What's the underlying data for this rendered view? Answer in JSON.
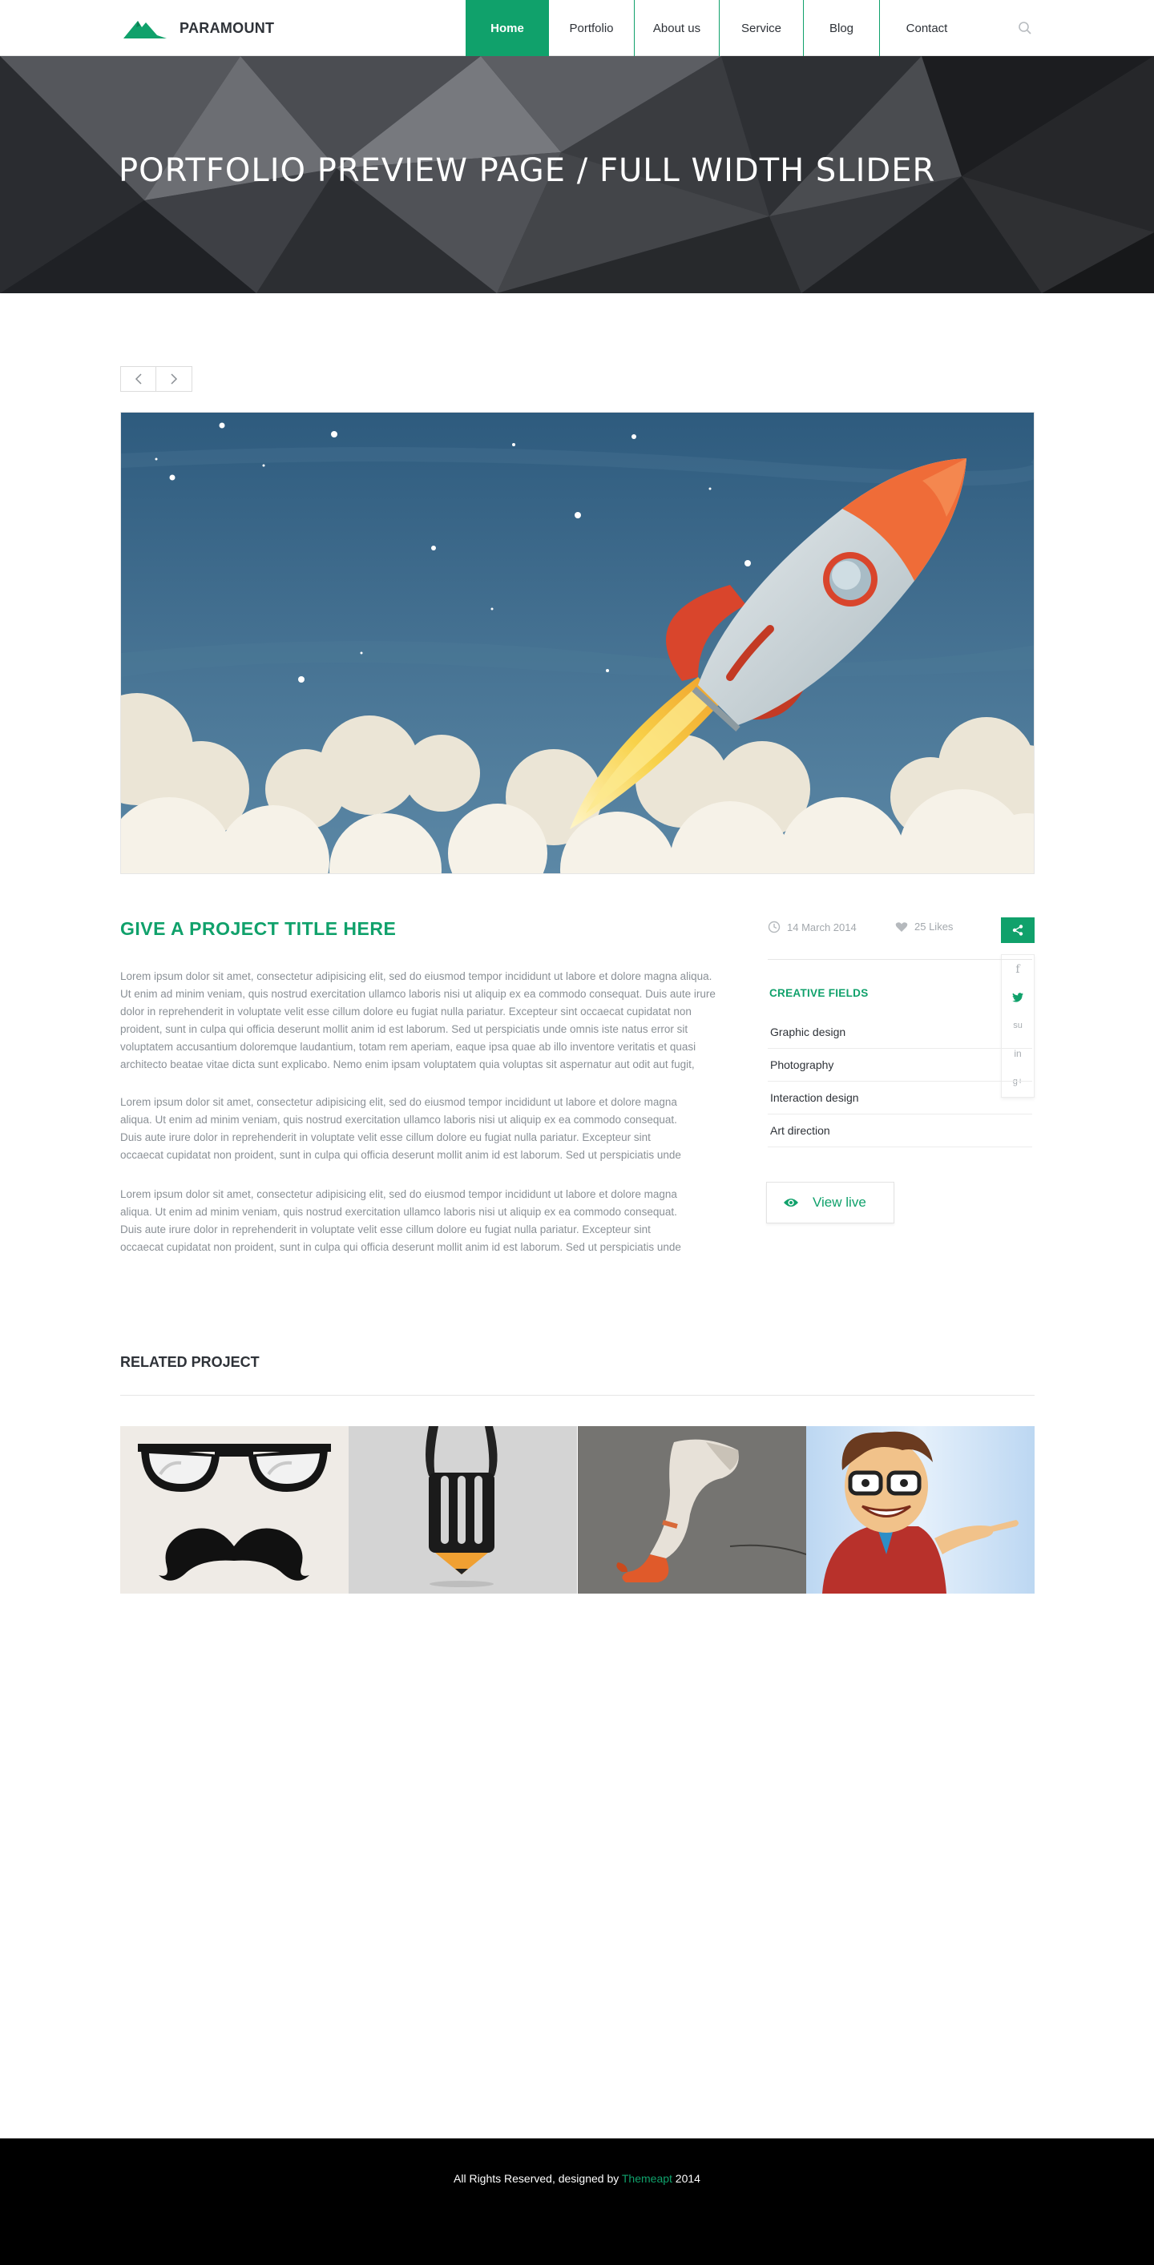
{
  "colors": {
    "accent": "#10a16b",
    "dark": "#2e3238",
    "muted": "#8a9096",
    "footer_bg": "#000000"
  },
  "header": {
    "logo_text": "PARAMOUNT",
    "nav": [
      {
        "label": "Home",
        "active": true
      },
      {
        "label": "Portfolio"
      },
      {
        "label": "About us"
      },
      {
        "label": "Service"
      },
      {
        "label": "Blog"
      },
      {
        "label": "Contact"
      }
    ],
    "search_icon": "search-icon"
  },
  "hero": {
    "title": "PORTFOLIO PREVIEW PAGE / FULL WIDTH SLIDER"
  },
  "slider": {
    "prev_icon": "chevron-left-icon",
    "next_icon": "chevron-right-icon"
  },
  "project": {
    "title": "GIVE A PROJECT TITLE HERE",
    "paragraphs": [
      "Lorem ipsum dolor sit amet, consectetur adipisicing elit, sed do eiusmod tempor incididunt ut labore et dolore magna aliqua. Ut enim ad minim veniam, quis nostrud exercitation ullamco laboris nisi ut aliquip ex ea commodo consequat. Duis aute irure dolor in reprehenderit in voluptate velit esse cillum dolore eu fugiat nulla pariatur. Excepteur sint occaecat cupidatat non proident, sunt in culpa qui officia deserunt mollit anim id est laborum. Sed ut perspiciatis unde omnis iste natus error sit voluptatem accusantium doloremque laudantium, totam rem aperiam, eaque ipsa quae ab illo inventore veritatis et quasi architecto beatae vitae dicta sunt explicabo. Nemo enim ipsam voluptatem quia voluptas sit aspernatur aut odit aut fugit,",
      "Lorem ipsum dolor sit amet, consectetur adipisicing elit, sed do eiusmod tempor incididunt ut labore et dolore magna aliqua. Ut enim ad minim veniam, quis nostrud exercitation ullamco laboris nisi ut aliquip ex ea commodo consequat. Duis aute irure dolor in reprehenderit in voluptate velit esse cillum dolore eu fugiat nulla pariatur. Excepteur sint occaecat cupidatat non proident, sunt in culpa qui officia deserunt mollit anim id est laborum. Sed ut perspiciatis unde",
      "Lorem ipsum dolor sit amet, consectetur adipisicing elit, sed do eiusmod tempor incididunt ut labore et dolore magna aliqua. Ut enim ad minim veniam, quis nostrud exercitation ullamco laboris nisi ut aliquip ex ea commodo consequat. Duis aute irure dolor in reprehenderit in voluptate velit esse cillum dolore eu fugiat nulla pariatur. Excepteur sint occaecat cupidatat non proident, sunt in culpa qui officia deserunt mollit anim id est laborum. Sed ut perspiciatis unde"
    ],
    "date": "14 March 2014",
    "likes": "25 Likes",
    "share_icon": "share-icon",
    "share_items": [
      {
        "icon": "facebook-icon",
        "glyph": "f"
      },
      {
        "icon": "twitter-icon",
        "glyph": "t"
      },
      {
        "icon": "stumbleupon-icon",
        "glyph": "su"
      },
      {
        "icon": "linkedin-icon",
        "glyph": "in"
      },
      {
        "icon": "googleplus-icon",
        "glyph": "g+"
      }
    ],
    "creative_fields_title": "CREATIVE FIELDS",
    "creative_fields": [
      "Graphic design",
      "Photography",
      "Interaction design",
      "Art direction"
    ],
    "view_live_label": "View live"
  },
  "related": {
    "title": "RELATED PROJECT",
    "tiles": [
      "glasses-mustache-image",
      "pencil-hand-image",
      "paint-tube-image",
      "cartoon-man-image"
    ]
  },
  "footer": {
    "text_before": "All Rights Reserved, designed by ",
    "brand": "Themeapt",
    "text_after": " 2014"
  }
}
